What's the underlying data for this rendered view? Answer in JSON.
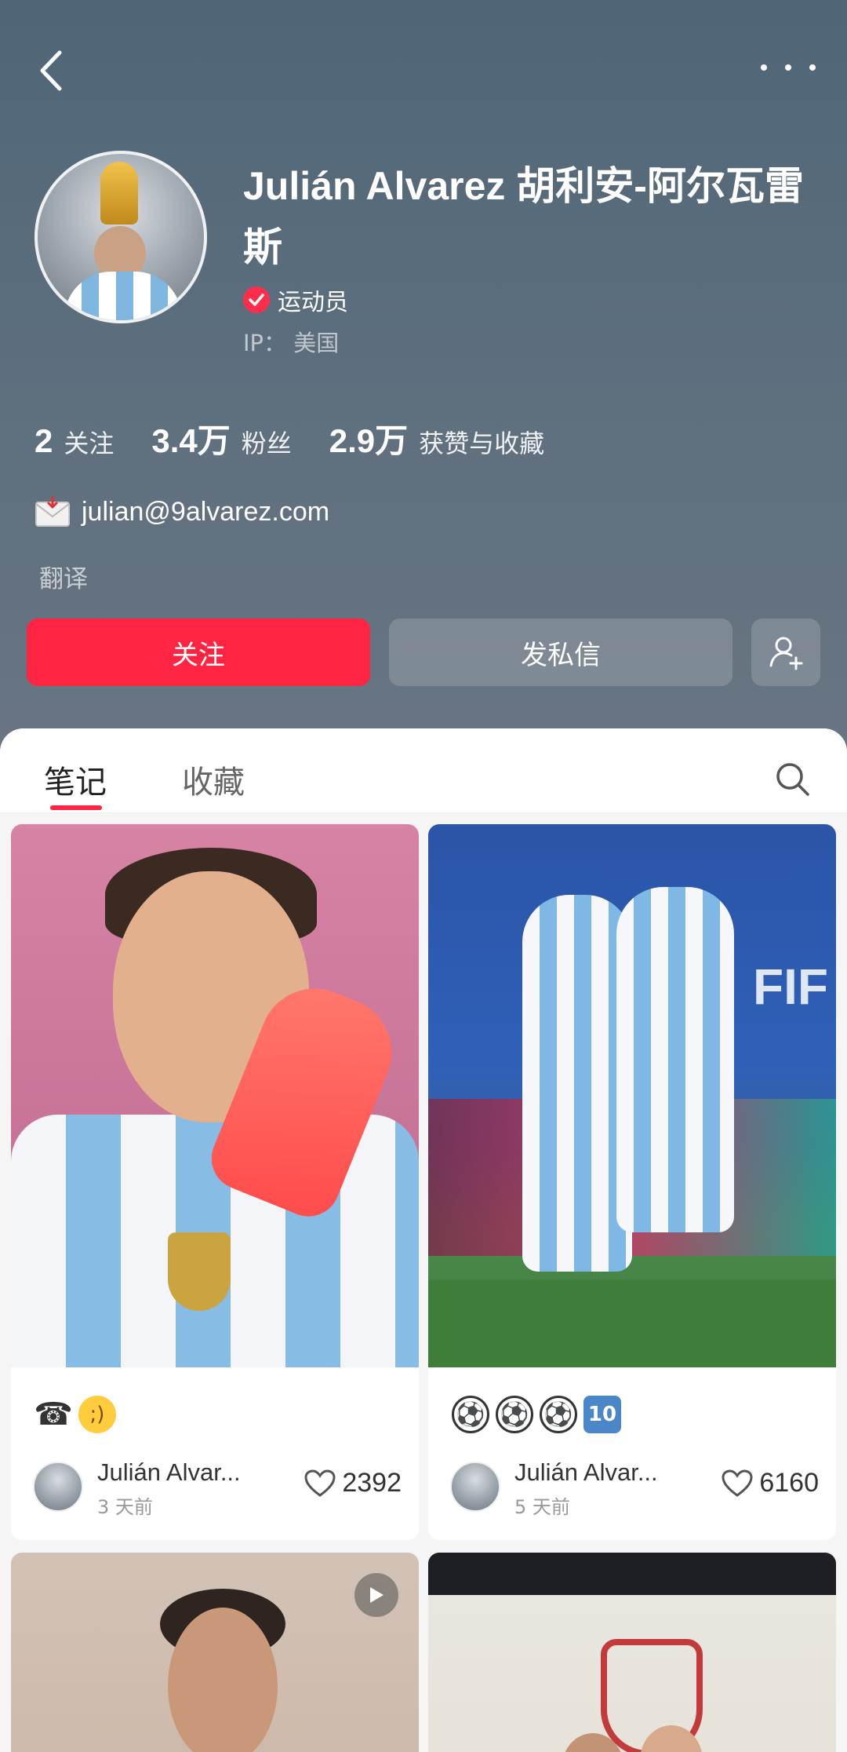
{
  "nav": {
    "back_icon": "chevron-left-icon",
    "more_icon": "more-icon"
  },
  "profile": {
    "name": "Julián Alvarez 胡利安-阿尔瓦雷斯",
    "verified_label": "运动员",
    "ip": "IP： 美国",
    "stats": [
      {
        "value": "2",
        "label": "关注"
      },
      {
        "value": "3.4万",
        "label": "粉丝"
      },
      {
        "value": "2.9万",
        "label": "获赞与收藏"
      }
    ],
    "email": "julian@9alvarez.com",
    "translate_label": "翻译"
  },
  "actions": {
    "follow": "关注",
    "message": "发私信",
    "add_friend_icon": "add-user-icon"
  },
  "tabs": {
    "notes": "笔记",
    "collections": "收藏"
  },
  "notes": [
    {
      "author": "Julián Alvar...",
      "time": "3 天前",
      "likes": "2392"
    },
    {
      "author": "Julián Alvar...",
      "time": "5 天前",
      "likes": "6160"
    }
  ],
  "colors": {
    "accent": "#ff2442",
    "header_bg": "#5a6c7b"
  }
}
